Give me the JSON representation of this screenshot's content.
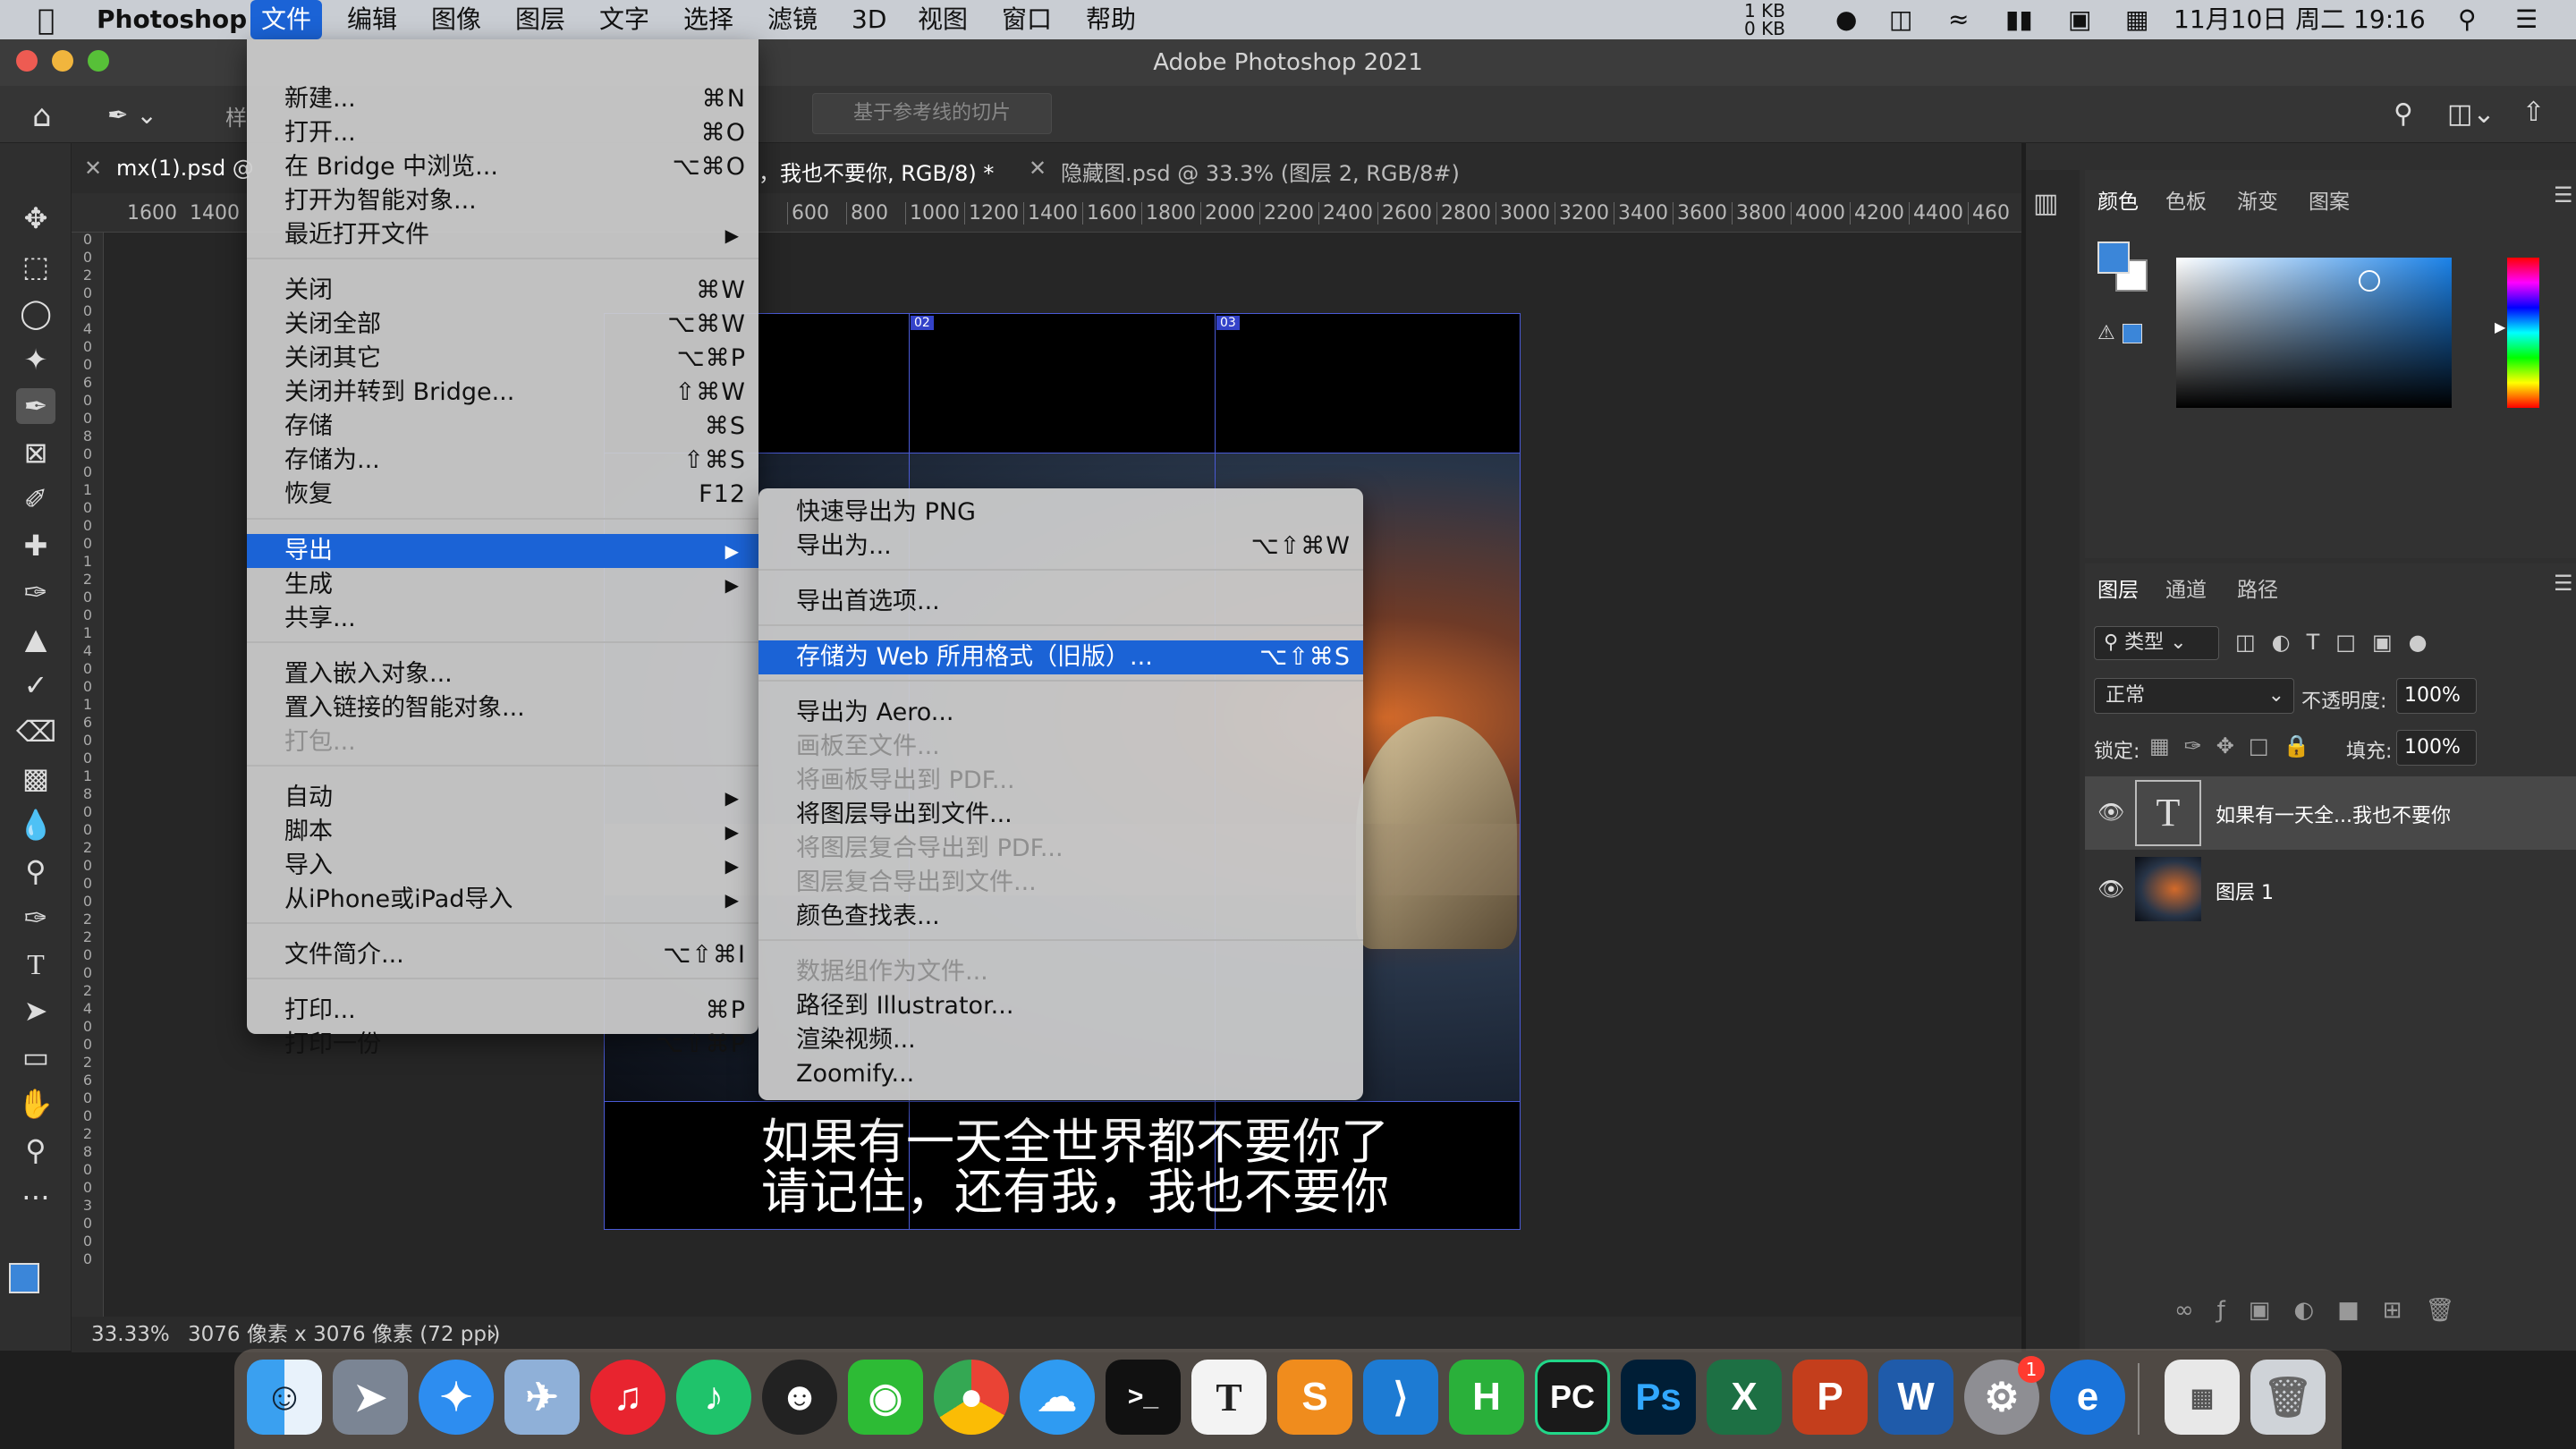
{
  "menubar": {
    "app": "Photoshop",
    "items": [
      "文件",
      "编辑",
      "图像",
      "图层",
      "文字",
      "选择",
      "滤镜",
      "3D",
      "视图",
      "窗口",
      "帮助"
    ],
    "net_up": "1 KB",
    "net_down": "0 KB",
    "datetime": "11月10日 周二  19:16"
  },
  "window": {
    "title": "Adobe Photoshop 2021"
  },
  "options": {
    "slice_button": "基于参考线的切片",
    "style_label": "样"
  },
  "tabs": [
    {
      "label": "mx(1).psd @"
    },
    {
      "label": "，我也不要你, RGB/8) *"
    },
    {
      "label": "隐藏图.psd @ 33.3% (图层 2, RGB/8#)"
    }
  ],
  "ruler": {
    "left_ticks": [
      "1600",
      "1400"
    ],
    "ticks": [
      "600",
      "800",
      "1000",
      "1200",
      "1400",
      "1600",
      "1800",
      "2000",
      "2200",
      "2400",
      "2600",
      "2800",
      "3000",
      "3200",
      "3400",
      "3600",
      "3800",
      "4000",
      "4200",
      "4400",
      "460"
    ],
    "vertical_digits": [
      "0",
      "0",
      "2",
      "0",
      "0",
      "4",
      "0",
      "0",
      "6",
      "0",
      "0",
      "8",
      "0",
      "0",
      "1",
      "0",
      "0",
      "0",
      "1",
      "2",
      "0",
      "0",
      "1",
      "4",
      "0",
      "0",
      "1",
      "6",
      "0",
      "0",
      "1",
      "8",
      "0",
      "0",
      "2",
      "0",
      "0",
      "0",
      "2",
      "2",
      "0",
      "0",
      "2",
      "4",
      "0",
      "0",
      "2",
      "6",
      "0",
      "0",
      "2",
      "8",
      "0",
      "0",
      "3",
      "0",
      "0",
      "0"
    ]
  },
  "document": {
    "slices": [
      "02",
      "03"
    ],
    "caption_line1": "如果有一天全世界都不要你了",
    "caption_line2": "请记住，还有我，我也不要你"
  },
  "status": {
    "zoom": "33.33%",
    "info": "3076 像素 x 3076 像素 (72 ppi)"
  },
  "file_menu": {
    "items": [
      {
        "label": "新建...",
        "shortcut": "⌘N"
      },
      {
        "label": "打开...",
        "shortcut": "⌘O"
      },
      {
        "label": "在 Bridge 中浏览...",
        "shortcut": "⌥⌘O"
      },
      {
        "label": "打开为智能对象..."
      },
      {
        "label": "最近打开文件",
        "arrow": "▶"
      },
      {
        "label": "关闭",
        "shortcut": "⌘W"
      },
      {
        "label": "关闭全部",
        "shortcut": "⌥⌘W"
      },
      {
        "label": "关闭其它",
        "shortcut": "⌥⌘P"
      },
      {
        "label": "关闭并转到 Bridge...",
        "shortcut": "⇧⌘W"
      },
      {
        "label": "存储",
        "shortcut": "⌘S"
      },
      {
        "label": "存储为...",
        "shortcut": "⇧⌘S"
      },
      {
        "label": "恢复",
        "shortcut": "F12"
      },
      {
        "label": "导出",
        "arrow": "▶"
      },
      {
        "label": "生成",
        "arrow": "▶"
      },
      {
        "label": "共享..."
      },
      {
        "label": "置入嵌入对象..."
      },
      {
        "label": "置入链接的智能对象..."
      },
      {
        "label": "打包..."
      },
      {
        "label": "自动",
        "arrow": "▶"
      },
      {
        "label": "脚本",
        "arrow": "▶"
      },
      {
        "label": "导入",
        "arrow": "▶"
      },
      {
        "label": "从iPhone或iPad导入",
        "arrow": "▶"
      },
      {
        "label": "文件简介...",
        "shortcut": "⌥⇧⌘I"
      },
      {
        "label": "打印...",
        "shortcut": "⌘P"
      },
      {
        "label": "打印一份",
        "shortcut": "⌥⇧⌘P"
      }
    ]
  },
  "export_submenu": {
    "items": [
      {
        "label": "快速导出为 PNG"
      },
      {
        "label": "导出为...",
        "shortcut": "⌥⇧⌘W"
      },
      {
        "label": "导出首选项..."
      },
      {
        "label": "存储为 Web 所用格式（旧版）...",
        "shortcut": "⌥⇧⌘S"
      },
      {
        "label": "导出为 Aero..."
      },
      {
        "label": "画板至文件..."
      },
      {
        "label": "将画板导出到 PDF..."
      },
      {
        "label": "将图层导出到文件..."
      },
      {
        "label": "将图层复合导出到 PDF..."
      },
      {
        "label": "图层复合导出到文件..."
      },
      {
        "label": "颜色查找表..."
      },
      {
        "label": "数据组作为文件..."
      },
      {
        "label": "路径到 Illustrator..."
      },
      {
        "label": "渲染视频..."
      },
      {
        "label": "Zoomify..."
      }
    ]
  },
  "color_panel": {
    "tabs": [
      "颜色",
      "色板",
      "渐变",
      "图案"
    ],
    "fg_color": "#3b86d9"
  },
  "layers_panel": {
    "tabs": [
      "图层",
      "通道",
      "路径"
    ],
    "filter": "类型",
    "blend_mode": "正常",
    "opacity_label": "不透明度:",
    "opacity": "100%",
    "lock_label": "锁定:",
    "fill_label": "填充:",
    "fill": "100%",
    "layers": [
      {
        "name": "如果有一天全...我也不要你",
        "thumb": "T"
      },
      {
        "name": "图层 1"
      }
    ]
  },
  "dock": {
    "ps": "Ps",
    "x": "X",
    "p": "P",
    "w": "W",
    "pc": "PC",
    "h": "H",
    "t": "T",
    "s": "S",
    "badge": "1"
  }
}
